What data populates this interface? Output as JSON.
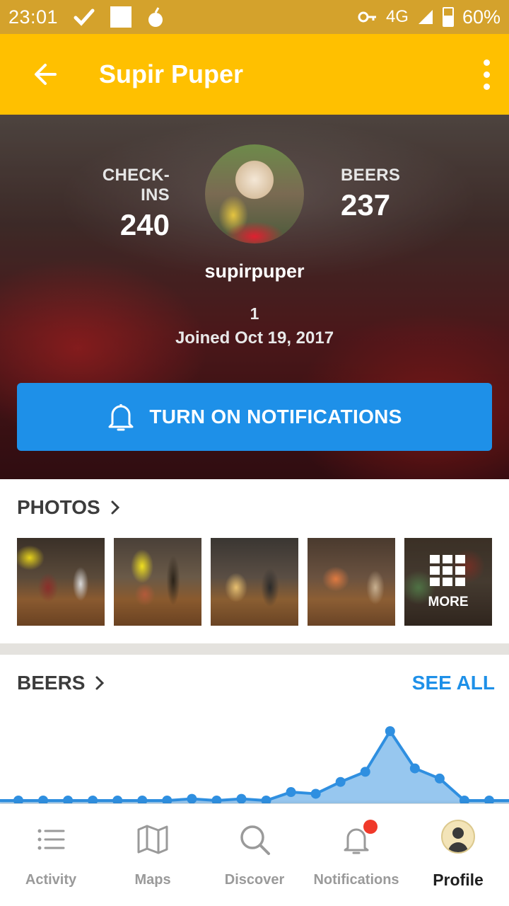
{
  "status_bar": {
    "time": "23:01",
    "network": "4G",
    "battery": "60%"
  },
  "app_bar": {
    "title": "Supir Puper"
  },
  "profile": {
    "checkins_label": "CHECK-INS",
    "checkins_value": "240",
    "beers_label": "BEERS",
    "beers_value": "237",
    "username": "supirpuper",
    "level": "1",
    "joined": "Joined Oct 19, 2017",
    "notify_button": "TURN ON NOTIFICATIONS"
  },
  "photos": {
    "title": "PHOTOS",
    "more_label": "MORE"
  },
  "beers": {
    "title": "BEERS",
    "see_all": "SEE ALL",
    "chart_data": {
      "type": "area",
      "values": [
        0,
        0,
        0,
        0,
        0,
        0,
        0,
        1,
        0,
        1,
        0,
        5,
        4,
        11,
        17,
        41,
        19,
        13,
        0,
        0
      ],
      "color": "#2f8fe0"
    }
  },
  "bottom_nav": {
    "items": [
      {
        "label": "Activity"
      },
      {
        "label": "Maps"
      },
      {
        "label": "Discover"
      },
      {
        "label": "Notifications"
      },
      {
        "label": "Profile"
      }
    ]
  },
  "colors": {
    "status_bar": "#d4a22c",
    "app_bar": "#ffc000",
    "accent": "#1e90e8",
    "badge": "#f0392a"
  }
}
